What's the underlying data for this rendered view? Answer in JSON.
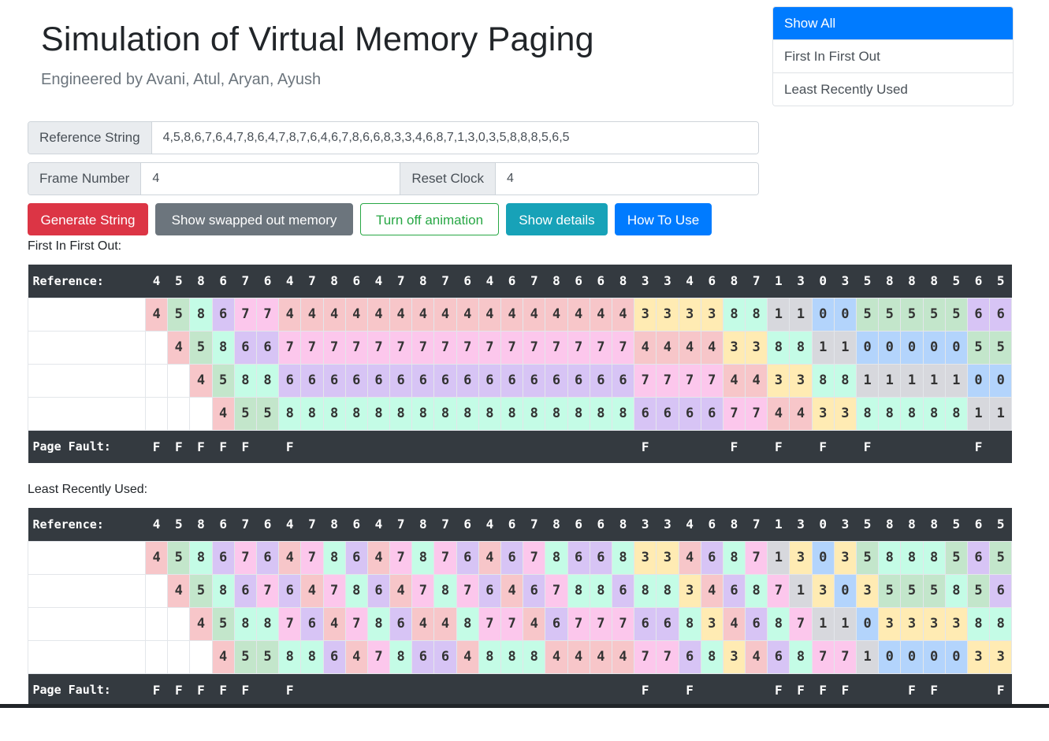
{
  "header": {
    "title": "Simulation of Virtual Memory Paging",
    "subtitle": "Engineered by Avani, Atul, Aryan, Ayush"
  },
  "algorithm_menu": {
    "items": [
      {
        "label": "Show All",
        "active": true
      },
      {
        "label": "First In First Out",
        "active": false
      },
      {
        "label": "Least Recently Used",
        "active": false
      }
    ]
  },
  "inputs": {
    "reference_label": "Reference String",
    "reference_value": "4,5,8,6,7,6,4,7,8,6,4,7,8,7,6,4,6,7,8,6,6,8,3,3,4,6,8,7,1,3,0,3,5,8,8,8,5,6,5",
    "frame_label": "Frame Number",
    "frame_value": "4",
    "reset_label": "Reset Clock",
    "reset_value": "4"
  },
  "buttons": {
    "generate": "Generate String",
    "swapped": "Show swapped out memory",
    "animation": "Turn off animation",
    "details": "Show details",
    "howto": "How To Use"
  },
  "colors": {
    "0": "#b3d4fc",
    "1": "#d7d8dd",
    "3": "#ffebb3",
    "4": "#f7c6c9",
    "5": "#c3e6cb",
    "6": "#d7c4f5",
    "7": "#fcc7ec",
    "8": "#c4fce6",
    "header_bg": "#343a40",
    "primary": "#007bff",
    "danger": "#dc3545",
    "secondary": "#6c757d",
    "success": "#28a745",
    "info": "#17a2b8"
  },
  "fifo": {
    "label": "First In First Out:",
    "reference_label": "Reference:",
    "fault_label": "Page Fault:",
    "reference": [
      "4",
      "5",
      "8",
      "6",
      "7",
      "6",
      "4",
      "7",
      "8",
      "6",
      "4",
      "7",
      "8",
      "7",
      "6",
      "4",
      "6",
      "7",
      "8",
      "6",
      "6",
      "8",
      "3",
      "3",
      "4",
      "6",
      "8",
      "7",
      "1",
      "3",
      "0",
      "3",
      "5",
      "8",
      "8",
      "8",
      "5",
      "6",
      "5"
    ],
    "frames": [
      [
        "4",
        "5",
        "8",
        "6",
        "7",
        "7",
        "4",
        "4",
        "4",
        "4",
        "4",
        "4",
        "4",
        "4",
        "4",
        "4",
        "4",
        "4",
        "4",
        "4",
        "4",
        "4",
        "3",
        "3",
        "3",
        "3",
        "8",
        "8",
        "1",
        "1",
        "0",
        "0",
        "5",
        "5",
        "5",
        "5",
        "5",
        "6",
        "6"
      ],
      [
        "",
        "4",
        "5",
        "8",
        "6",
        "6",
        "7",
        "7",
        "7",
        "7",
        "7",
        "7",
        "7",
        "7",
        "7",
        "7",
        "7",
        "7",
        "7",
        "7",
        "7",
        "7",
        "4",
        "4",
        "4",
        "4",
        "3",
        "3",
        "8",
        "8",
        "1",
        "1",
        "0",
        "0",
        "0",
        "0",
        "0",
        "5",
        "5"
      ],
      [
        "",
        "",
        "4",
        "5",
        "8",
        "8",
        "6",
        "6",
        "6",
        "6",
        "6",
        "6",
        "6",
        "6",
        "6",
        "6",
        "6",
        "6",
        "6",
        "6",
        "6",
        "6",
        "7",
        "7",
        "7",
        "7",
        "4",
        "4",
        "3",
        "3",
        "8",
        "8",
        "1",
        "1",
        "1",
        "1",
        "1",
        "0",
        "0"
      ],
      [
        "",
        "",
        "",
        "4",
        "5",
        "5",
        "8",
        "8",
        "8",
        "8",
        "8",
        "8",
        "8",
        "8",
        "8",
        "8",
        "8",
        "8",
        "8",
        "8",
        "8",
        "8",
        "6",
        "6",
        "6",
        "6",
        "7",
        "7",
        "4",
        "4",
        "3",
        "3",
        "8",
        "8",
        "8",
        "8",
        "8",
        "1",
        "1"
      ]
    ],
    "faults": [
      "F",
      "F",
      "F",
      "F",
      "F",
      "",
      "F",
      "",
      "",
      "",
      "",
      "",
      "",
      "",
      "",
      "",
      "",
      "",
      "",
      "",
      "",
      "",
      "F",
      "",
      "",
      "",
      "F",
      "",
      "F",
      "",
      "F",
      "",
      "F",
      "",
      "",
      "",
      "",
      "F",
      ""
    ]
  },
  "lru": {
    "label": "Least Recently Used:",
    "reference_label": "Reference:",
    "fault_label": "Page Fault:",
    "reference": [
      "4",
      "5",
      "8",
      "6",
      "7",
      "6",
      "4",
      "7",
      "8",
      "6",
      "4",
      "7",
      "8",
      "7",
      "6",
      "4",
      "6",
      "7",
      "8",
      "6",
      "6",
      "8",
      "3",
      "3",
      "4",
      "6",
      "8",
      "7",
      "1",
      "3",
      "0",
      "3",
      "5",
      "8",
      "8",
      "8",
      "5",
      "6",
      "5"
    ],
    "frames": [
      [
        "4",
        "5",
        "8",
        "6",
        "7",
        "6",
        "4",
        "7",
        "8",
        "6",
        "4",
        "7",
        "8",
        "7",
        "6",
        "4",
        "6",
        "7",
        "8",
        "6",
        "6",
        "8",
        "3",
        "3",
        "4",
        "6",
        "8",
        "7",
        "1",
        "3",
        "0",
        "3",
        "5",
        "8",
        "8",
        "8",
        "5",
        "6",
        "5"
      ],
      [
        "",
        "4",
        "5",
        "8",
        "6",
        "7",
        "6",
        "4",
        "7",
        "8",
        "6",
        "4",
        "7",
        "8",
        "7",
        "6",
        "4",
        "6",
        "7",
        "8",
        "8",
        "6",
        "8",
        "8",
        "3",
        "4",
        "6",
        "8",
        "7",
        "1",
        "3",
        "0",
        "3",
        "5",
        "5",
        "5",
        "8",
        "5",
        "6"
      ],
      [
        "",
        "",
        "4",
        "5",
        "8",
        "8",
        "7",
        "6",
        "4",
        "7",
        "8",
        "6",
        "4",
        "4",
        "8",
        "7",
        "7",
        "4",
        "6",
        "7",
        "7",
        "7",
        "6",
        "6",
        "8",
        "3",
        "4",
        "6",
        "8",
        "7",
        "1",
        "1",
        "0",
        "3",
        "3",
        "3",
        "3",
        "8",
        "8"
      ],
      [
        "",
        "",
        "",
        "4",
        "5",
        "5",
        "8",
        "8",
        "6",
        "4",
        "7",
        "8",
        "6",
        "6",
        "4",
        "8",
        "8",
        "8",
        "4",
        "4",
        "4",
        "4",
        "7",
        "7",
        "6",
        "8",
        "3",
        "4",
        "6",
        "8",
        "7",
        "7",
        "1",
        "0",
        "0",
        "0",
        "0",
        "3",
        "3"
      ]
    ],
    "faults": [
      "F",
      "F",
      "F",
      "F",
      "F",
      "",
      "F",
      "",
      "",
      "",
      "",
      "",
      "",
      "",
      "",
      "",
      "",
      "",
      "",
      "",
      "",
      "",
      "F",
      "",
      "F",
      "",
      "",
      "",
      "F",
      "F",
      "F",
      "F",
      "",
      "",
      "F",
      "F",
      "",
      "",
      "F"
    ]
  }
}
